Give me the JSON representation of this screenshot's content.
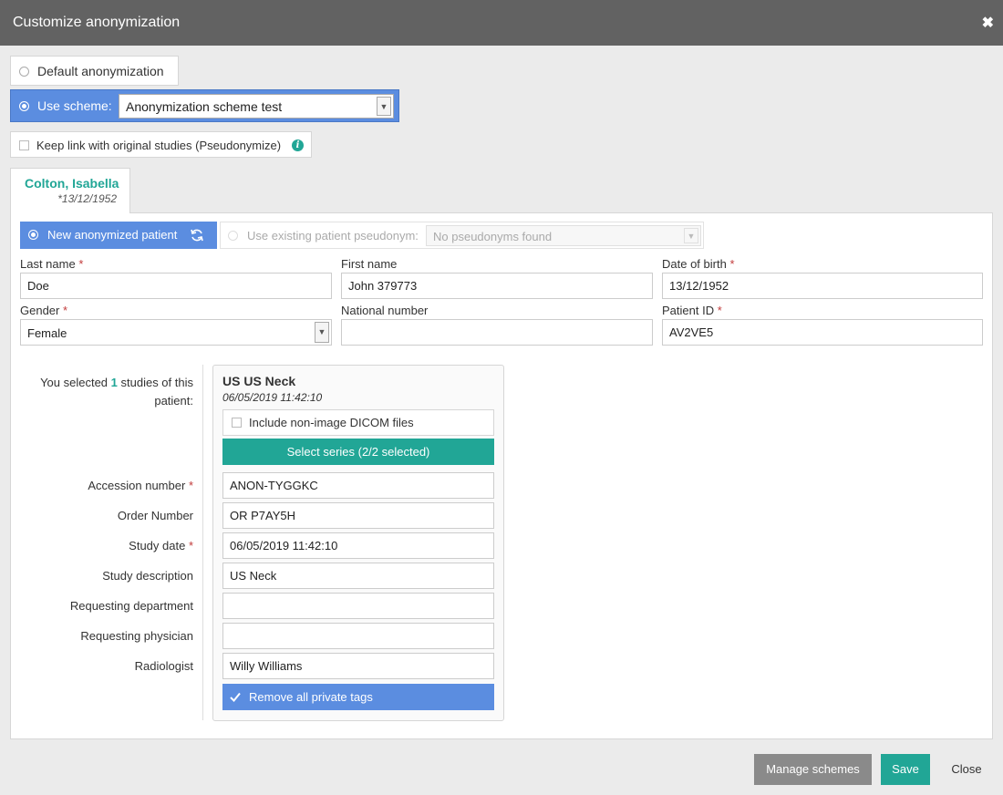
{
  "dialog": {
    "title": "Customize anonymization",
    "close_glyph": "✖"
  },
  "mode": {
    "default_label": "Default anonymization",
    "scheme_label": "Use scheme:",
    "scheme_selected": "Anonymization scheme test",
    "pseudonymize_label": "Keep link with original studies (Pseudonymize)"
  },
  "patient_tab": {
    "name": "Colton, Isabella",
    "dob": "*13/12/1952"
  },
  "patient_mode": {
    "new_label": "New anonymized patient",
    "existing_label": "Use existing patient pseudonym:",
    "existing_placeholder": "No pseudonyms found"
  },
  "patient": {
    "last_name_label": "Last name",
    "last_name": "Doe",
    "first_name_label": "First name",
    "first_name": "John 379773",
    "dob_label": "Date of birth",
    "dob": "13/12/1952",
    "gender_label": "Gender",
    "gender": "Female",
    "national_label": "National number",
    "national": "",
    "pid_label": "Patient ID",
    "pid": "AV2VE5",
    "required_mark": "*"
  },
  "selection": {
    "prefix": "You selected ",
    "count": "1",
    "suffix": " studies of this patient:"
  },
  "study": {
    "title": "US US Neck",
    "datetime": "06/05/2019 11:42:10",
    "include_label": "Include non-image DICOM files",
    "series_button": "Select series (2/2 selected)",
    "remove_tags": "Remove all private tags",
    "fields": {
      "accession_label": "Accession number",
      "accession": "ANON-TYGGKC",
      "order_label": "Order Number",
      "order": "OR P7AY5H",
      "study_date_label": "Study date",
      "study_date": "06/05/2019 11:42:10",
      "desc_label": "Study description",
      "desc": "US Neck",
      "dept_label": "Requesting department",
      "dept": "",
      "physician_label": "Requesting physician",
      "physician": "",
      "radiologist_label": "Radiologist",
      "radiologist": "Willy Williams"
    }
  },
  "footer": {
    "manage": "Manage schemes",
    "save": "Save",
    "close": "Close"
  },
  "colors": {
    "accent_blue": "#5b8de0",
    "accent_teal": "#21a696",
    "title_bar": "#626262"
  }
}
